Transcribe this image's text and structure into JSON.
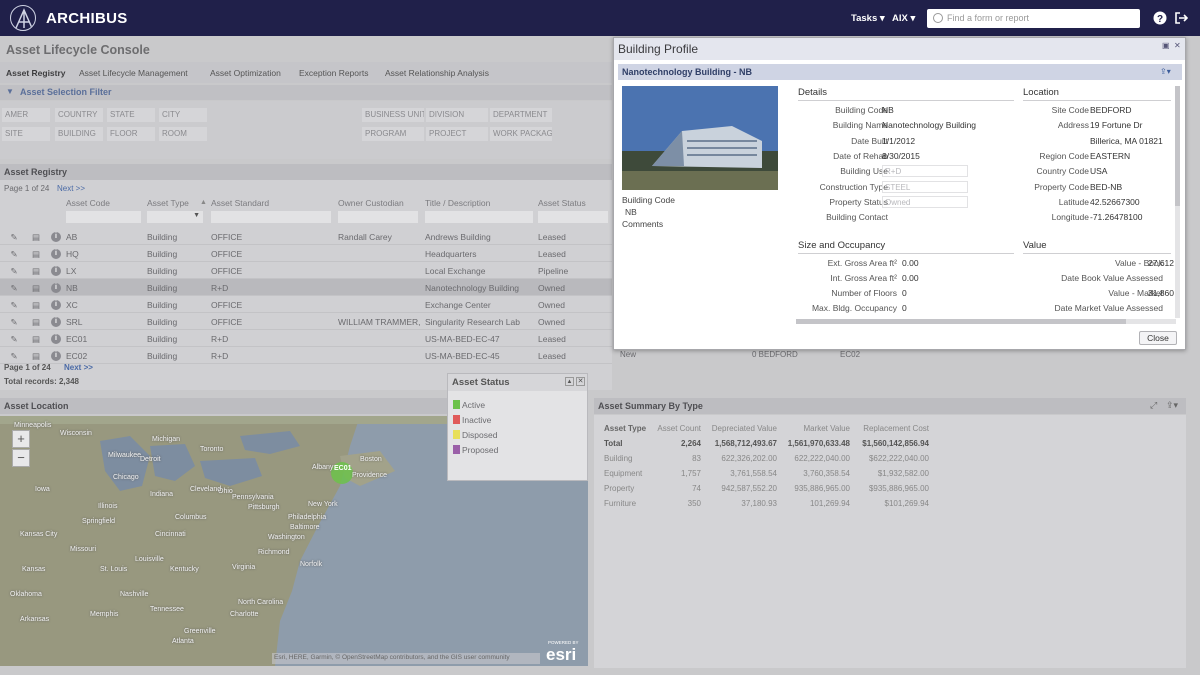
{
  "app": {
    "name": "ARCHIBUS"
  },
  "topbar": {
    "tasks_label": "Tasks ▾",
    "user_label": "AIX ▾",
    "search_placeholder": "Find a form or report",
    "help_icon": "help-icon",
    "logout_icon": "logout-icon"
  },
  "console_title": "Asset Lifecycle Console",
  "tabs": [
    "Asset Registry",
    "Asset Lifecycle Management",
    "Asset Optimization",
    "Exception Reports",
    "Asset Relationship Analysis"
  ],
  "filter": {
    "title": "Asset Selection Filter",
    "fields_row1": [
      "AMER",
      "COUNTRY",
      "STATE",
      "CITY",
      "BUSINESS UNIT",
      "DIVISION",
      "DEPARTMENT"
    ],
    "fields_row2": [
      "SITE",
      "BUILDING",
      "FLOOR",
      "ROOM",
      "PROGRAM",
      "PROJECT",
      "WORK PACKAGE"
    ]
  },
  "registry": {
    "title": "Asset Registry",
    "page_info": "Page 1 of 24",
    "next_label": "Next >>",
    "columns": [
      "Asset Code",
      "Asset Type",
      "Asset Standard",
      "Owner Custodian",
      "Title / Description",
      "Asset Status"
    ],
    "rows": [
      {
        "code": "AB",
        "type": "Building",
        "standard": "OFFICE",
        "owner": "Randall Carey",
        "title": "Andrews Building",
        "status": "Leased"
      },
      {
        "code": "HQ",
        "type": "Building",
        "standard": "OFFICE",
        "owner": "",
        "title": "Headquarters",
        "status": "Leased"
      },
      {
        "code": "LX",
        "type": "Building",
        "standard": "OFFICE",
        "owner": "",
        "title": "Local Exchange",
        "status": "Pipeline"
      },
      {
        "code": "NB",
        "type": "Building",
        "standard": "R+D",
        "owner": "",
        "title": "Nanotechnology Building",
        "status": "Owned"
      },
      {
        "code": "XC",
        "type": "Building",
        "standard": "OFFICE",
        "owner": "",
        "title": "Exchange Center",
        "status": "Owned"
      },
      {
        "code": "SRL",
        "type": "Building",
        "standard": "OFFICE",
        "owner": "WILLIAM TRAMMER,",
        "title": "Singularity Research Lab",
        "status": "Owned"
      },
      {
        "code": "EC01",
        "type": "Building",
        "standard": "R+D",
        "owner": "",
        "title": "US-MA-BED-EC-47",
        "status": "Leased"
      },
      {
        "code": "EC02",
        "type": "Building",
        "standard": "R+D",
        "owner": "",
        "title": "US-MA-BED-EC-45",
        "status": "Leased"
      }
    ],
    "hidden_row_extra": {
      "status2": "New",
      "site": "0  BEDFORD",
      "bldg": "EC02"
    },
    "footer_page": "Page 1 of 24",
    "footer_next": "Next >>",
    "total": "Total records: 2,348"
  },
  "location": {
    "title": "Asset Location",
    "map_labels": [
      "Minneapolis",
      "Wisconsin",
      "Milwaukee",
      "Chicago",
      "Iowa",
      "Illinois",
      "Ohio",
      "Indiana",
      "Toronto",
      "Detroit",
      "Cleveland",
      "Pittsburgh",
      "Columbus",
      "Pennsylvania",
      "New York",
      "Philadelphia",
      "Providence",
      "Boston",
      "Albany",
      "Kansas City",
      "Missouri",
      "St. Louis",
      "Kentucky",
      "Nashville",
      "Tennessee",
      "Virginia",
      "North Carolina",
      "Charlotte",
      "Arkansas",
      "Atlanta",
      "Oklahoma",
      "Memphis",
      "Louisville",
      "Cincinnati",
      "Washington",
      "Baltimore",
      "Greenville",
      "Richmond",
      "Norfolk",
      "Kansas",
      "Springfield",
      "Michigan"
    ],
    "marker_label": "EC01",
    "attribution": "Esri, HERE, Garmin, © OpenStreetMap contributors, and the GIS user community",
    "esri_powered": "POWERED BY",
    "esri": "esri",
    "zoom_in": "+",
    "zoom_out": "−"
  },
  "asset_status_popup": {
    "title": "Asset Status",
    "items": [
      {
        "label": "Active",
        "color": "#6cc24a"
      },
      {
        "label": "Inactive",
        "color": "#e05a5a"
      },
      {
        "label": "Disposed",
        "color": "#e8df5a"
      },
      {
        "label": "Proposed",
        "color": "#9a5fa8"
      }
    ]
  },
  "summary": {
    "title": "Asset Summary By Type",
    "columns": [
      "Asset Type",
      "Asset Count",
      "Depreciated Value",
      "Market Value",
      "Replacement Cost"
    ],
    "rows": [
      {
        "type": "Total",
        "count": "2,264",
        "dep": "1,568,712,493.67",
        "market": "1,561,970,633.48",
        "repl": "$1,560,142,856.94"
      },
      {
        "type": "Building",
        "count": "83",
        "dep": "622,326,202.00",
        "market": "622,222,040.00",
        "repl": "$622,222,040.00"
      },
      {
        "type": "Equipment",
        "count": "1,757",
        "dep": "3,761,558.54",
        "market": "3,760,358.54",
        "repl": "$1,932,582.00"
      },
      {
        "type": "Property",
        "count": "74",
        "dep": "942,587,552.20",
        "market": "935,886,965.00",
        "repl": "$935,886,965.00"
      },
      {
        "type": "Furniture",
        "count": "350",
        "dep": "37,180.93",
        "market": "101,269.94",
        "repl": "$101,269.94"
      }
    ]
  },
  "profile": {
    "title": "Building Profile",
    "subtitle": "Nanotechnology Building - NB",
    "photo_labels": {
      "code_label": "Building Code",
      "code_value": "NB",
      "comments_label": "Comments"
    },
    "details_title": "Details",
    "details": [
      {
        "label": "Building Code",
        "value": "NB"
      },
      {
        "label": "Building Name",
        "value": "Nanotechnology Building"
      },
      {
        "label": "Date Built",
        "value": "1/1/2012"
      },
      {
        "label": "Date of Rehab",
        "value": "8/30/2015"
      },
      {
        "label": "Building Use",
        "value": "R+D"
      },
      {
        "label": "Construction Type",
        "value": "STEEL"
      },
      {
        "label": "Property Status",
        "value": "Owned"
      },
      {
        "label": "Building Contact",
        "value": ""
      }
    ],
    "location_title": "Location",
    "location": [
      {
        "label": "Site Code",
        "value": "BEDFORD"
      },
      {
        "label": "Address",
        "value": "19 Fortune Dr"
      },
      {
        "label": "",
        "value": "Billerica, MA 01821"
      },
      {
        "label": "Region Code",
        "value": "EASTERN"
      },
      {
        "label": "Country Code",
        "value": "USA"
      },
      {
        "label": "Property Code",
        "value": "BED-NB"
      },
      {
        "label": "Latitude",
        "value": "42.52667300"
      },
      {
        "label": "Longitude",
        "value": "-71.26478100"
      }
    ],
    "size_title": "Size and Occupancy",
    "size": [
      {
        "label": "Ext. Gross Area ft²",
        "value": "0.00"
      },
      {
        "label": "Int. Gross Area ft²",
        "value": "0.00"
      },
      {
        "label": "Number of Floors",
        "value": "0"
      },
      {
        "label": "Max. Bldg. Occupancy",
        "value": "0"
      }
    ],
    "value_title": "Value",
    "value": [
      {
        "label": "Value - Book",
        "value": "27,612"
      },
      {
        "label": "Date Book Value Assessed",
        "value": ""
      },
      {
        "label": "Value - Market",
        "value": "31,860"
      },
      {
        "label": "Date Market Value Assessed",
        "value": ""
      }
    ],
    "close_label": "Close"
  }
}
